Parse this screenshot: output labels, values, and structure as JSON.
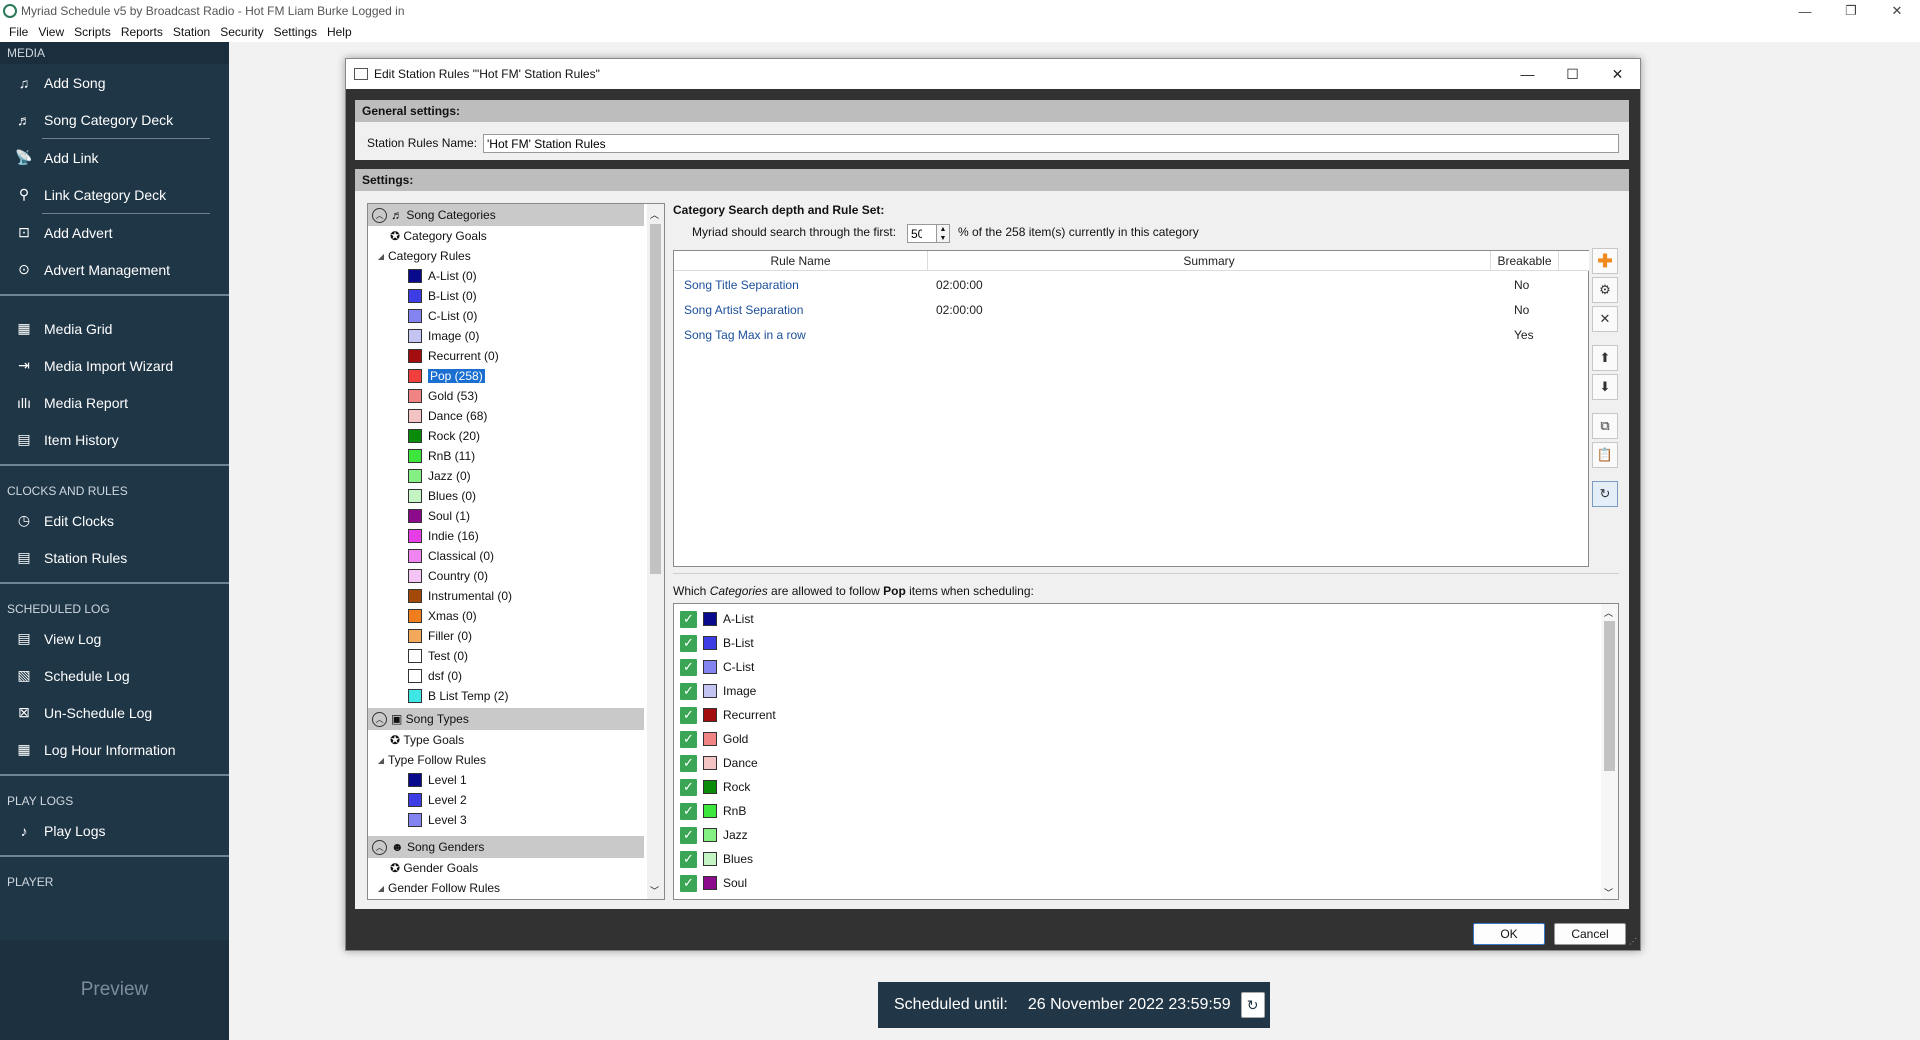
{
  "window": {
    "title": "Myriad Schedule v5 by Broadcast Radio - Hot FM Liam Burke Logged in"
  },
  "menu": [
    "File",
    "View",
    "Scripts",
    "Reports",
    "Station",
    "Security",
    "Settings",
    "Help"
  ],
  "sidebar": {
    "media_head": "MEDIA",
    "media": [
      "Add Song",
      "Song Category Deck",
      "Add Link",
      "Link Category Deck",
      "Add Advert",
      "Advert Management",
      "Media Grid",
      "Media Import Wizard",
      "Media Report",
      "Item History"
    ],
    "clocks_head": "CLOCKS AND RULES",
    "clocks": [
      "Edit Clocks",
      "Station Rules"
    ],
    "log_head": "SCHEDULED LOG",
    "log": [
      "View Log",
      "Schedule Log",
      "Un-Schedule Log",
      "Log Hour Information"
    ],
    "play_head": "PLAY LOGS",
    "play": [
      "Play Logs"
    ],
    "player_head": "PLAYER",
    "preview": "Preview"
  },
  "dialog": {
    "title": "Edit Station Rules \"'Hot FM' Station Rules\"",
    "general_head": "General settings:",
    "name_label": "Station Rules Name:",
    "name_value": "'Hot FM' Station Rules",
    "settings_head": "Settings:",
    "ok": "OK",
    "cancel": "Cancel"
  },
  "tree": {
    "song_categories": "Song Categories",
    "category_goals": "Category Goals",
    "category_rules": "Category Rules",
    "categories": [
      {
        "label": "A-List (0)",
        "color": "#0a0a8c"
      },
      {
        "label": "B-List (0)",
        "color": "#3d3de6"
      },
      {
        "label": "C-List (0)",
        "color": "#8484f0"
      },
      {
        "label": "Image (0)",
        "color": "#c4c4f2"
      },
      {
        "label": "Recurrent (0)",
        "color": "#a30d0d"
      },
      {
        "label": "Pop (258)",
        "color": "#f03d3d"
      },
      {
        "label": "Gold (53)",
        "color": "#f08484"
      },
      {
        "label": "Dance (68)",
        "color": "#f4c4c4"
      },
      {
        "label": "Rock (20)",
        "color": "#0a8c0a"
      },
      {
        "label": "RnB (11)",
        "color": "#3de63d"
      },
      {
        "label": "Jazz (0)",
        "color": "#84f084"
      },
      {
        "label": "Blues (0)",
        "color": "#c4f4c4"
      },
      {
        "label": "Soul (1)",
        "color": "#8c0a8c"
      },
      {
        "label": "Indie (16)",
        "color": "#e63de6"
      },
      {
        "label": "Classical (0)",
        "color": "#f084f0"
      },
      {
        "label": "Country (0)",
        "color": "#f4c4f4"
      },
      {
        "label": "Instrumental (0)",
        "color": "#a34a0a"
      },
      {
        "label": "Xmas (0)",
        "color": "#f07d1e"
      },
      {
        "label": "Filler (0)",
        "color": "#f4a85a"
      },
      {
        "label": "Test (0)",
        "color": "#ffffff"
      },
      {
        "label": "dsf (0)",
        "color": "#ffffff"
      },
      {
        "label": "B List Temp (2)",
        "color": "#3ee6e6"
      }
    ],
    "song_types": "Song Types",
    "type_goals": "Type Goals",
    "type_follow_rules": "Type Follow Rules",
    "levels": [
      {
        "label": "Level 1",
        "color": "#0a0a8c"
      },
      {
        "label": "Level 2",
        "color": "#3d3de6"
      },
      {
        "label": "Level 3",
        "color": "#8484f0"
      }
    ],
    "song_genders": "Song Genders",
    "gender_goals": "Gender Goals",
    "gender_follow_rules": "Gender Follow Rules"
  },
  "rules": {
    "heading": "Category Search depth and Rule Set:",
    "search_prefix": "Myriad should search through the first:",
    "search_value": "50",
    "search_suffix": "% of the 258 item(s) currently in this category",
    "columns": [
      "Rule Name",
      "Summary",
      "Breakable"
    ],
    "rows": [
      {
        "name": "Song Title Separation",
        "summary": "02:00:00",
        "breakable": "No"
      },
      {
        "name": "Song Artist Separation",
        "summary": "02:00:00",
        "breakable": "No"
      },
      {
        "name": "Song Tag Max in a row",
        "summary": "",
        "breakable": "Yes"
      }
    ]
  },
  "follow": {
    "prefix": "Which ",
    "categories_word": "Categories",
    "middle": " are allowed to follow ",
    "current": "Pop",
    "suffix": " items when scheduling:",
    "items": [
      {
        "label": "A-List",
        "color": "#0a0a8c"
      },
      {
        "label": "B-List",
        "color": "#3d3de6"
      },
      {
        "label": "C-List",
        "color": "#8484f0"
      },
      {
        "label": "Image",
        "color": "#c4c4f2"
      },
      {
        "label": "Recurrent",
        "color": "#a30d0d"
      },
      {
        "label": "Gold",
        "color": "#f08484"
      },
      {
        "label": "Dance",
        "color": "#f4c4c4"
      },
      {
        "label": "Rock",
        "color": "#0a8c0a"
      },
      {
        "label": "RnB",
        "color": "#3de63d"
      },
      {
        "label": "Jazz",
        "color": "#84f084"
      },
      {
        "label": "Blues",
        "color": "#c4f4c4"
      },
      {
        "label": "Soul",
        "color": "#8c0a8c"
      }
    ]
  },
  "schedule": {
    "label": "Scheduled until:",
    "value": "26 November 2022 23:59:59"
  }
}
